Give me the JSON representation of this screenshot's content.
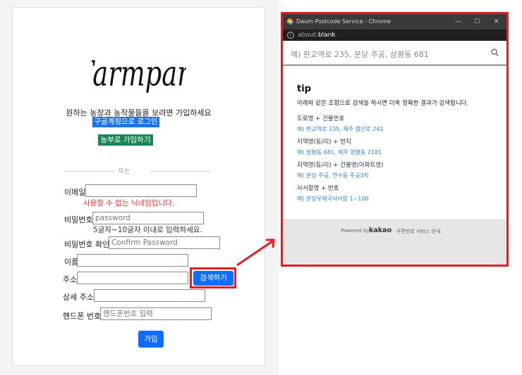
{
  "signup": {
    "logo_text": "Farmpam",
    "intro": "원하는 농장과 농작물들을 보려면 가입하세요",
    "google_login": "구글계정으로 로그인",
    "farmer_signup": "농부로 가입하기",
    "divider": "또는",
    "email_label": "이메일",
    "email_error": "사용할 수 없는 닉네임입니다.",
    "password_label": "비밀번호",
    "password_placeholder": "password",
    "password_hint": "5글자~10글자 이내로 입력하세요.",
    "confirm_label": "비밀번호 확인",
    "confirm_placeholder": "Confirm Password",
    "name_label": "이름",
    "address_label": "주소",
    "search_button": "검색하기",
    "detail_address_label": "상세 주소",
    "phone_label": "핸드폰 번호",
    "phone_placeholder": "핸드폰번호 입력",
    "submit": "가입"
  },
  "popup": {
    "window_title": "Daum Postcode Service - Chrome",
    "controls": {
      "minimize": "—",
      "maximize": "☐",
      "close": "✕"
    },
    "url_scheme": "about:",
    "url_host": "blank",
    "search_placeholder": "예) 판교역로 235, 분당 주공, 삼평동 681",
    "tip_title": "tip",
    "tip_desc": "아래와 같은 조합으로 검색을 하시면 더욱 정확한 결과가 검색됩니다.",
    "examples": [
      {
        "title": "도로명 + 건물번호",
        "value": "예) 판교역로 235,  제주 첨단로 242"
      },
      {
        "title": "지역명(동/리) + 번지",
        "value": "예) 삼평동 681,  제주 영평동 2181"
      },
      {
        "title": "지역명(동/리) + 건물명(아파트명)",
        "value": "예) 분당 주공,  연수동 주공3차"
      },
      {
        "title": "사서함명 + 번호",
        "value": "예) 분당우체국사서함 1~100"
      }
    ],
    "powered_by": "Powered by",
    "kakao": "kakao",
    "separator": "|",
    "guide": "우편번호 서비스 안내"
  },
  "colors": {
    "google_button": "#1a73e8",
    "farmer_button": "#198754",
    "primary_button": "#0d6efd",
    "error_text": "#e03030",
    "highlight": "#e11f26",
    "example_link": "#2b7fd1"
  },
  "icons": [
    "chrome-icon",
    "info-icon",
    "magnifier-icon",
    "arrow-annotation"
  ]
}
